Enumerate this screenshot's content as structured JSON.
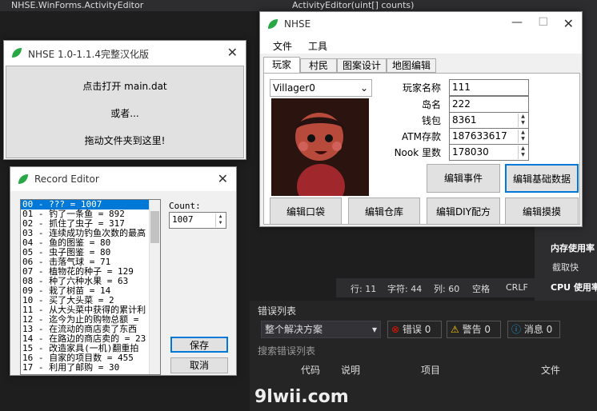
{
  "vs": {
    "title_left": "NHSE.WinForms.ActivityEditor",
    "title_right": "ActivityEditor(uint[] counts)",
    "status": {
      "row": "行: 11",
      "char": "字符: 44",
      "col": "列: 60",
      "space": "空格",
      "crlf": "CRLF"
    },
    "right_panel": {
      "item1": "内存使用率",
      "item2": "截取快",
      "item3": "CPU 使用率"
    },
    "error_list": {
      "title": "错误列表",
      "scope": "整个解决方案",
      "errors": "错误 0",
      "warnings": "警告 0",
      "messages": "消息 0",
      "search_placeholder": "搜索错误列表",
      "columns": [
        "代码",
        "说明",
        "项目",
        "文件"
      ]
    },
    "watermark": "9lwii.com"
  },
  "nhse_main": {
    "title": "NHSE 1.0-1.1.4完整汉化版",
    "open_text": "点击打开 main.dat",
    "or_text": "或者...",
    "drag_text": "拖动文件夹到这里!"
  },
  "nhse_editor": {
    "title": "NHSE",
    "menu": [
      "文件",
      "工具"
    ],
    "tabs": [
      "玩家",
      "村民",
      "图案设计",
      "地图编辑"
    ],
    "villager_select": "Villager0",
    "labels": {
      "name": "玩家名称",
      "island": "岛名",
      "wallet": "钱包",
      "atm": "ATM存款",
      "nook": "Nook 里数"
    },
    "values": {
      "name": "111",
      "island": "222",
      "wallet": "8361",
      "atm": "187633617",
      "nook": "178030"
    },
    "buttons": {
      "edit_event": "编辑事件",
      "edit_basic": "编辑基础数据",
      "edit_pocket": "编辑口袋",
      "edit_storage": "编辑仓库",
      "edit_diy": "编辑DIY配方",
      "edit_pattern": "编辑摸摸"
    }
  },
  "record_editor": {
    "title": "Record Editor",
    "count_label": "Count:",
    "count_value": "1007",
    "save": "保存",
    "cancel": "取消",
    "items": [
      "00 - ??? = 1007",
      "01 - 钓了一条鱼 = 892",
      "02 - 抓住了虫子 = 317",
      "03 - 连续成功钓鱼次数的最高",
      "04 - 鱼的图鉴 = 80",
      "05 - 虫子图鉴 = 80",
      "06 - 击落气球 = 71",
      "07 - 植物花的种子 = 129",
      "08 - 种了六种水果 = 63",
      "09 - 栽了树苗 = 14",
      "10 - 买了大头菜 = 2",
      "11 - 从大头菜中获得的累计利",
      "12 - 迄今为止的购物总额 =",
      "13 - 在流动的商店卖了东西",
      "14 - 在路边的商店卖的 = 23",
      "15 - 改造家具(一机)翻重拍",
      "16 - 自家的项目数 = 455",
      "17 - 利用了邮购 = 30"
    ]
  }
}
